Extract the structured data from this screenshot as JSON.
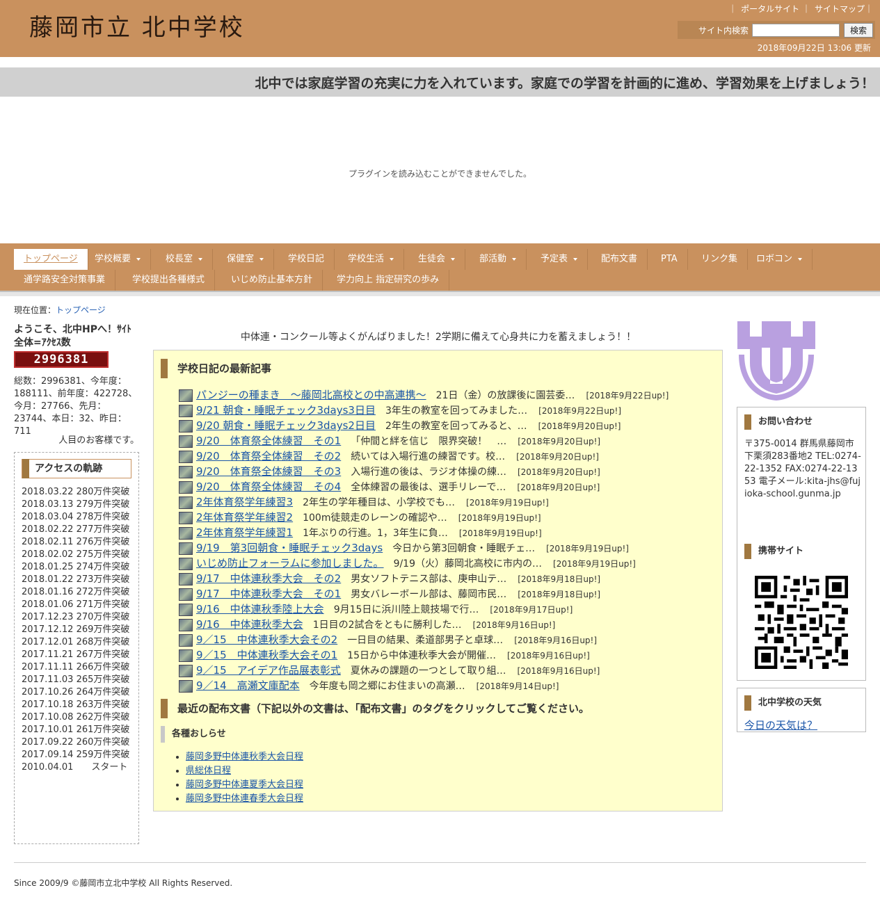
{
  "header": {
    "site_title": "藤岡市立 北中学校",
    "top_links": [
      "ポータルサイト",
      "サイトマップ"
    ],
    "search_label": "サイト内検索",
    "search_value": "",
    "search_button": "検索",
    "update_time": "2018年09月22日 13:06 更新"
  },
  "marquee": "北中では家庭学習の充実に力を入れています。家庭での学習を計画的に進め、学習効果を上げましょう！",
  "plugin_message": "プラグインを読み込むことができませんでした。",
  "nav": {
    "row1": [
      {
        "label": "トップページ",
        "dropdown": false,
        "active": true
      },
      {
        "label": "学校概要",
        "dropdown": true
      },
      {
        "label": "校長室",
        "dropdown": true
      },
      {
        "label": "保健室",
        "dropdown": true
      },
      {
        "label": "学校日記",
        "dropdown": false
      },
      {
        "label": "学校生活",
        "dropdown": true
      },
      {
        "label": "生徒会",
        "dropdown": true
      },
      {
        "label": "部活動",
        "dropdown": true
      },
      {
        "label": "予定表",
        "dropdown": true
      },
      {
        "label": "配布文書",
        "dropdown": false
      },
      {
        "label": "PTA",
        "dropdown": false
      },
      {
        "label": "リンク集",
        "dropdown": false
      },
      {
        "label": "ロボコン",
        "dropdown": true
      }
    ],
    "row2": [
      {
        "label": "通学路安全対策事業"
      },
      {
        "label": "学校提出各種様式"
      },
      {
        "label": "いじめ防止基本方針"
      },
      {
        "label": "学力向上 指定研究の歩み"
      }
    ]
  },
  "breadcrumb": {
    "prefix": "現在位置：",
    "current": "トップページ"
  },
  "left": {
    "welcome": "ようこそ、北中HPへ！ｻｲﾄ全体=ｱｸｾｽ数",
    "counter": "2996381",
    "stats": "総数：2996381、今年度：188111、前年度：422728、今月：27766、先月：23744、本日：32、昨日：711",
    "guest": "人目のお客様です。",
    "history_title": "アクセスの軌跡",
    "history_text": "2018.03.22 280万件突破 2018.03.13 279万件突破 2018.03.04 278万件突破 2018.02.22 277万件突破 2018.02.11 276万件突破 2018.02.02 275万件突破 2018.01.25 274万件突破 2018.01.22 273万件突破 2018.01.16 272万件突破 2018.01.06 271万件突破 2017.12.23 270万件突破 2017.12.12 269万件突破 2017.12.01 268万件突破 2017.11.21 267万件突破 2017.11.11 266万件突破 2017.11.03 265万件突破 2017.10.26 264万件突破 2017.10.18 263万件突破 2017.10.08 262万件突破 2017.10.01 261万件突破 2017.09.22 260万件突破 2017.09.14 259万件突破 2010.04.01　　スタート"
  },
  "center": {
    "notice": "中体連・コンクール等よくがんばりました！2学期に備えて心身共に力を蓄えましょう！！",
    "diary_title": "学校日記の最新記事",
    "diary": [
      {
        "title": "パンジーの種まき　～藤岡北高校との中高連携～",
        "desc": "21日（金）の放課後に園芸委…",
        "date": "[2018年9月22日up!]"
      },
      {
        "title": "9/21 朝食・睡眠チェック3days3日目",
        "desc": "3年生の教室を回ってみました…",
        "date": "[2018年9月22日up!]"
      },
      {
        "title": "9/20 朝食・睡眠チェック3days2日目",
        "desc": "2年生の教室を回ってみると、…",
        "date": "[2018年9月20日up!]"
      },
      {
        "title": "9/20　体育祭全体練習　その1",
        "desc": "「仲間と絆を信じ　限界突破！　…",
        "date": "[2018年9月20日up!]"
      },
      {
        "title": "9/20　体育祭全体練習　その2",
        "desc": "続いては入場行進の練習です。校…",
        "date": "[2018年9月20日up!]"
      },
      {
        "title": "9/20　体育祭全体練習　その3",
        "desc": "入場行進の後は、ラジオ体操の練…",
        "date": "[2018年9月20日up!]"
      },
      {
        "title": "9/20　体育祭全体練習　その4",
        "desc": "全体練習の最後は、選手リレーで…",
        "date": "[2018年9月20日up!]"
      },
      {
        "title": "2年体育祭学年練習3",
        "desc": "2年生の学年種目は、小学校でも…",
        "date": "[2018年9月19日up!]"
      },
      {
        "title": "2年体育祭学年練習2",
        "desc": "100m徒競走のレーンの確認や…",
        "date": "[2018年9月19日up!]"
      },
      {
        "title": "2年体育祭学年練習1",
        "desc": "1年ぶりの行進。1，3年生に負…",
        "date": "[2018年9月19日up!]"
      },
      {
        "title": "9/19　第3回朝食・睡眠チェック3days",
        "desc": "今日から第3回朝食・睡眠チェ…",
        "date": "[2018年9月19日up!]"
      },
      {
        "title": "いじめ防止フォーラムに参加しました。",
        "desc": "9/19（火）藤岡北高校に市内の…",
        "date": "[2018年9月19日up!]"
      },
      {
        "title": "9/17　中体連秋季大会　その2",
        "desc": "男女ソフトテニス部は、庚申山テ…",
        "date": "[2018年9月18日up!]"
      },
      {
        "title": "9/17　中体連秋季大会　その1",
        "desc": "男女バレーボール部は、藤岡市民…",
        "date": "[2018年9月18日up!]"
      },
      {
        "title": "9/16　中体連秋季陸上大会",
        "desc": "9月15日に浜川陸上競技場で行…",
        "date": "[2018年9月17日up!]"
      },
      {
        "title": "9/16　中体連秋季大会",
        "desc": "1日目の2試合をともに勝利した…",
        "date": "[2018年9月16日up!]"
      },
      {
        "title": "9／15　中体連秋季大会その2",
        "desc": "一日目の結果、柔道部男子と卓球…",
        "date": "[2018年9月16日up!]"
      },
      {
        "title": "9／15　中体連秋季大会その1",
        "desc": "15日から中体連秋季大会が開催…",
        "date": "[2018年9月16日up!]"
      },
      {
        "title": "9／15　アイデア作品展表彰式",
        "desc": "夏休みの課題の一つとして取り組…",
        "date": "[2018年9月16日up!]"
      },
      {
        "title": "9／14　高瀬文庫配本",
        "desc": "今年度も岡之郷にお住まいの高瀬…",
        "date": "[2018年9月14日up!]"
      }
    ],
    "docs_title": "最近の配布文書（下記以外の文書は、「配布文書」のタグをクリックしてご覧ください。",
    "docs_subtitle": "各種おしらせ",
    "docs": [
      "藤岡多野中体連秋季大会日程",
      "県総体日程",
      "藤岡多野中体連夏季大会日程",
      "藤岡多野中体連春季大会日程"
    ]
  },
  "right": {
    "contact_title": "お問い合わせ",
    "contact_text": "〒375-0014 群馬県藤岡市下栗須283番地2 TEL:0274-22-1352 FAX:0274-22-1353 電子メール:kita-jhs@fujioka-school.gunma.jp",
    "mobile_title": "携帯サイト",
    "weather_title": "北中学校の天気",
    "weather_link": "今日の天気は？"
  },
  "footer": "Since 2009/9 ©藤岡市立北中学校 All Rights Reserved.",
  "colors": {
    "header": "#c9915e",
    "accent": "#a07840",
    "link": "#1a55a8",
    "logo": "#b9a0e0"
  }
}
